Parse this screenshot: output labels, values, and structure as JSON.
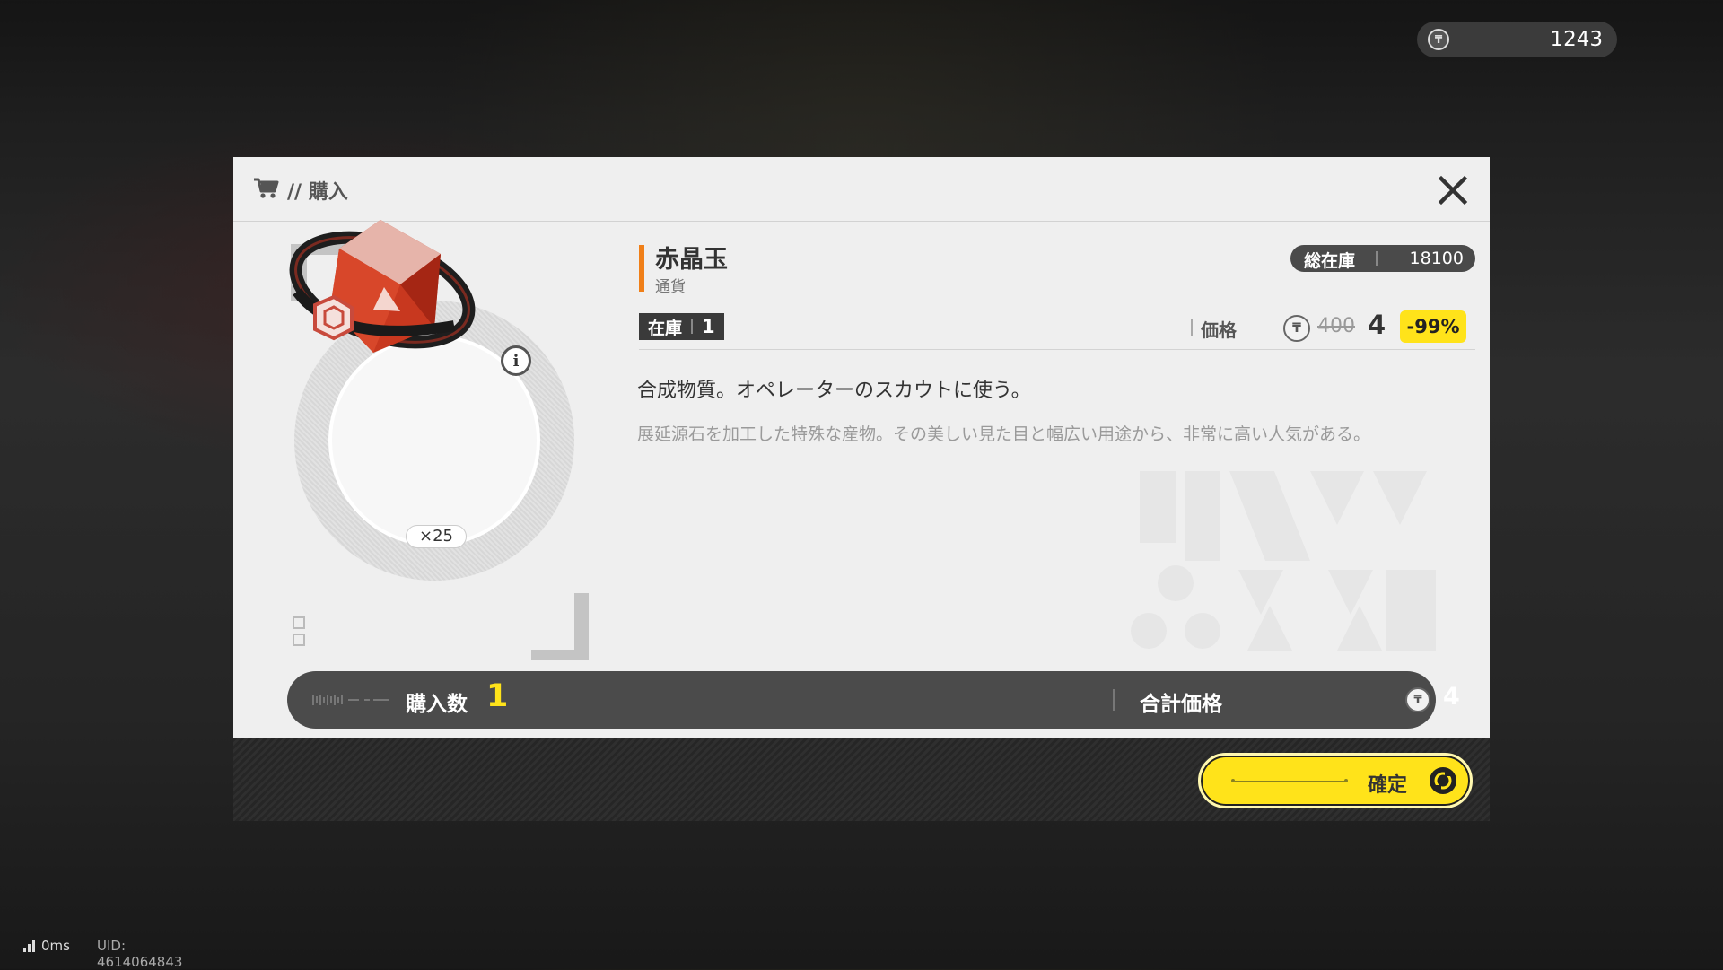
{
  "currency": {
    "icon": "coin-icon",
    "amount": "1243"
  },
  "dialog": {
    "title": "// 購入",
    "icons": {
      "cart": "cart-icon",
      "close": "close-icon"
    }
  },
  "item": {
    "name": "赤晶玉",
    "type": "通貨",
    "quantity_badge": "×25",
    "info_icon": "i",
    "total_stock_label": "総在庫",
    "total_stock": "18100",
    "stock_label": "在庫",
    "stock": "1",
    "price_label": "価格",
    "original_price": "400",
    "price": "4",
    "discount": "-99%",
    "description": "合成物質。オペレーターのスカウトに使う。",
    "flavor": "展延源石を加工した特殊な産物。その美しい見た目と幅広い用途から、非常に高い人気がある。"
  },
  "purchase": {
    "quantity_label": "購入数",
    "quantity": "1",
    "total_label": "合計価格",
    "total": "4"
  },
  "confirm": {
    "label": "確定"
  },
  "status": {
    "ping": "0ms",
    "uid": "UID: 4614064843"
  },
  "colors": {
    "accent_yellow": "#ffe31a",
    "accent_orange": "#f07f18",
    "dialog_bg": "#efefef",
    "dark_bar": "#4b4b4b"
  }
}
